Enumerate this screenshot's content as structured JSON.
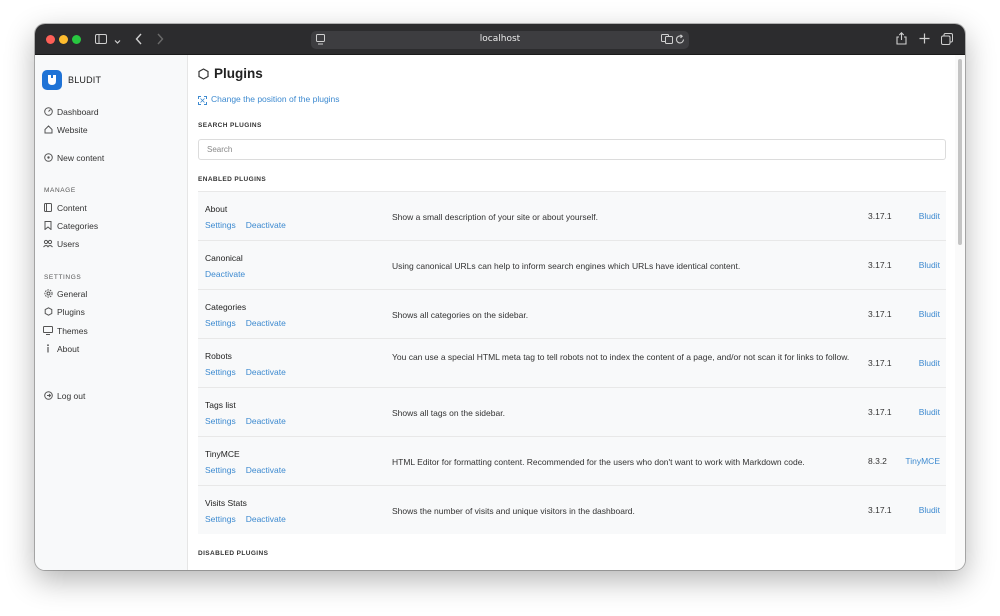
{
  "browser": {
    "url": "localhost",
    "icons": [
      "sidebar-toggle-icon",
      "chevron-down-icon",
      "back-icon",
      "forward-icon",
      "page-icon",
      "translate-icon",
      "reload-icon",
      "share-icon",
      "new-tab-icon",
      "tabs-overview-icon"
    ]
  },
  "sidebar": {
    "brand": "BLUDIT",
    "top_items": [
      {
        "label": "Dashboard",
        "icon": "dashboard-icon"
      },
      {
        "label": "Website",
        "icon": "home-icon"
      },
      {
        "label": "New content",
        "icon": "plus-circle-icon"
      }
    ],
    "manage_title": "MANAGE",
    "manage_items": [
      {
        "label": "Content",
        "icon": "file-icon"
      },
      {
        "label": "Categories",
        "icon": "bookmark-icon"
      },
      {
        "label": "Users",
        "icon": "users-icon"
      }
    ],
    "settings_title": "SETTINGS",
    "settings_items": [
      {
        "label": "General",
        "icon": "gear-icon"
      },
      {
        "label": "Plugins",
        "icon": "puzzle-icon"
      },
      {
        "label": "Themes",
        "icon": "monitor-icon"
      },
      {
        "label": "About",
        "icon": "info-icon"
      }
    ],
    "logout": {
      "label": "Log out",
      "icon": "logout-icon"
    }
  },
  "main": {
    "title": "Plugins",
    "change_position": "Change the position of the plugins",
    "search_title": "SEARCH PLUGINS",
    "search_placeholder": "Search",
    "enabled_title": "ENABLED PLUGINS",
    "disabled_title": "DISABLED PLUGINS",
    "plugins": [
      {
        "name": "About",
        "settings": "Settings",
        "deactivate": "Deactivate",
        "description": "Show a small description of your site or about yourself.",
        "version": "3.17.1",
        "author": "Bludit"
      },
      {
        "name": "Canonical",
        "settings": "",
        "deactivate": "Deactivate",
        "description": "Using canonical URLs can help to inform search engines which URLs have identical content.",
        "version": "3.17.1",
        "author": "Bludit"
      },
      {
        "name": "Categories",
        "settings": "Settings",
        "deactivate": "Deactivate",
        "description": "Shows all categories on the sidebar.",
        "version": "3.17.1",
        "author": "Bludit"
      },
      {
        "name": "Robots",
        "settings": "Settings",
        "deactivate": "Deactivate",
        "description": "You can use a special HTML meta tag to tell robots not to index the content of a page, and/or not scan it for links to follow.",
        "version": "3.17.1",
        "author": "Bludit"
      },
      {
        "name": "Tags list",
        "settings": "Settings",
        "deactivate": "Deactivate",
        "description": "Shows all tags on the sidebar.",
        "version": "3.17.1",
        "author": "Bludit"
      },
      {
        "name": "TinyMCE",
        "settings": "Settings",
        "deactivate": "Deactivate",
        "description": "HTML Editor for formatting content. Recommended for the users who don't want to work with Markdown code.",
        "version": "8.3.2",
        "author": "TinyMCE"
      },
      {
        "name": "Visits Stats",
        "settings": "Settings",
        "deactivate": "Deactivate",
        "description": "Shows the number of visits and unique visitors in the dashboard.",
        "version": "3.17.1",
        "author": "Bludit"
      }
    ]
  }
}
